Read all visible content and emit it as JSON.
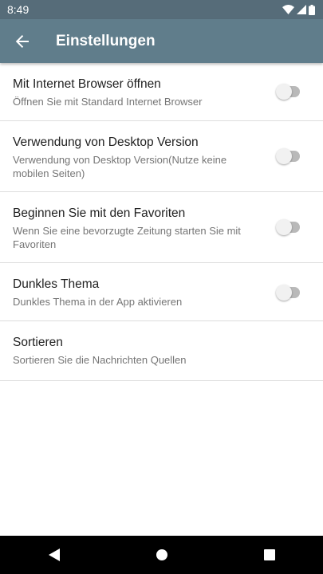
{
  "status_bar": {
    "time": "8:49"
  },
  "app_bar": {
    "title": "Einstellungen",
    "back_icon": "arrow-back-icon"
  },
  "settings": [
    {
      "title": "Mit Internet Browser öffnen",
      "summary": "Öffnen Sie mit Standard Internet Browser",
      "toggle": false
    },
    {
      "title": "Verwendung von Desktop Version",
      "summary": "Verwendung von Desktop Version(Nutze keine mobilen Seiten)",
      "toggle": false
    },
    {
      "title": "Beginnen Sie mit den Favoriten",
      "summary": "Wenn Sie eine bevorzugte Zeitung starten Sie mit Favoriten",
      "toggle": false
    },
    {
      "title": "Dunkles Thema",
      "summary": "Dunkles Thema in der App aktivieren",
      "toggle": false
    },
    {
      "title": "Sortieren",
      "summary": "Sortieren Sie die Nachrichten Quellen"
    }
  ],
  "colors": {
    "app_bar": "#607d8b",
    "status_bar": "#566c79",
    "nav_bar": "#000000",
    "divider": "#dddddd"
  }
}
